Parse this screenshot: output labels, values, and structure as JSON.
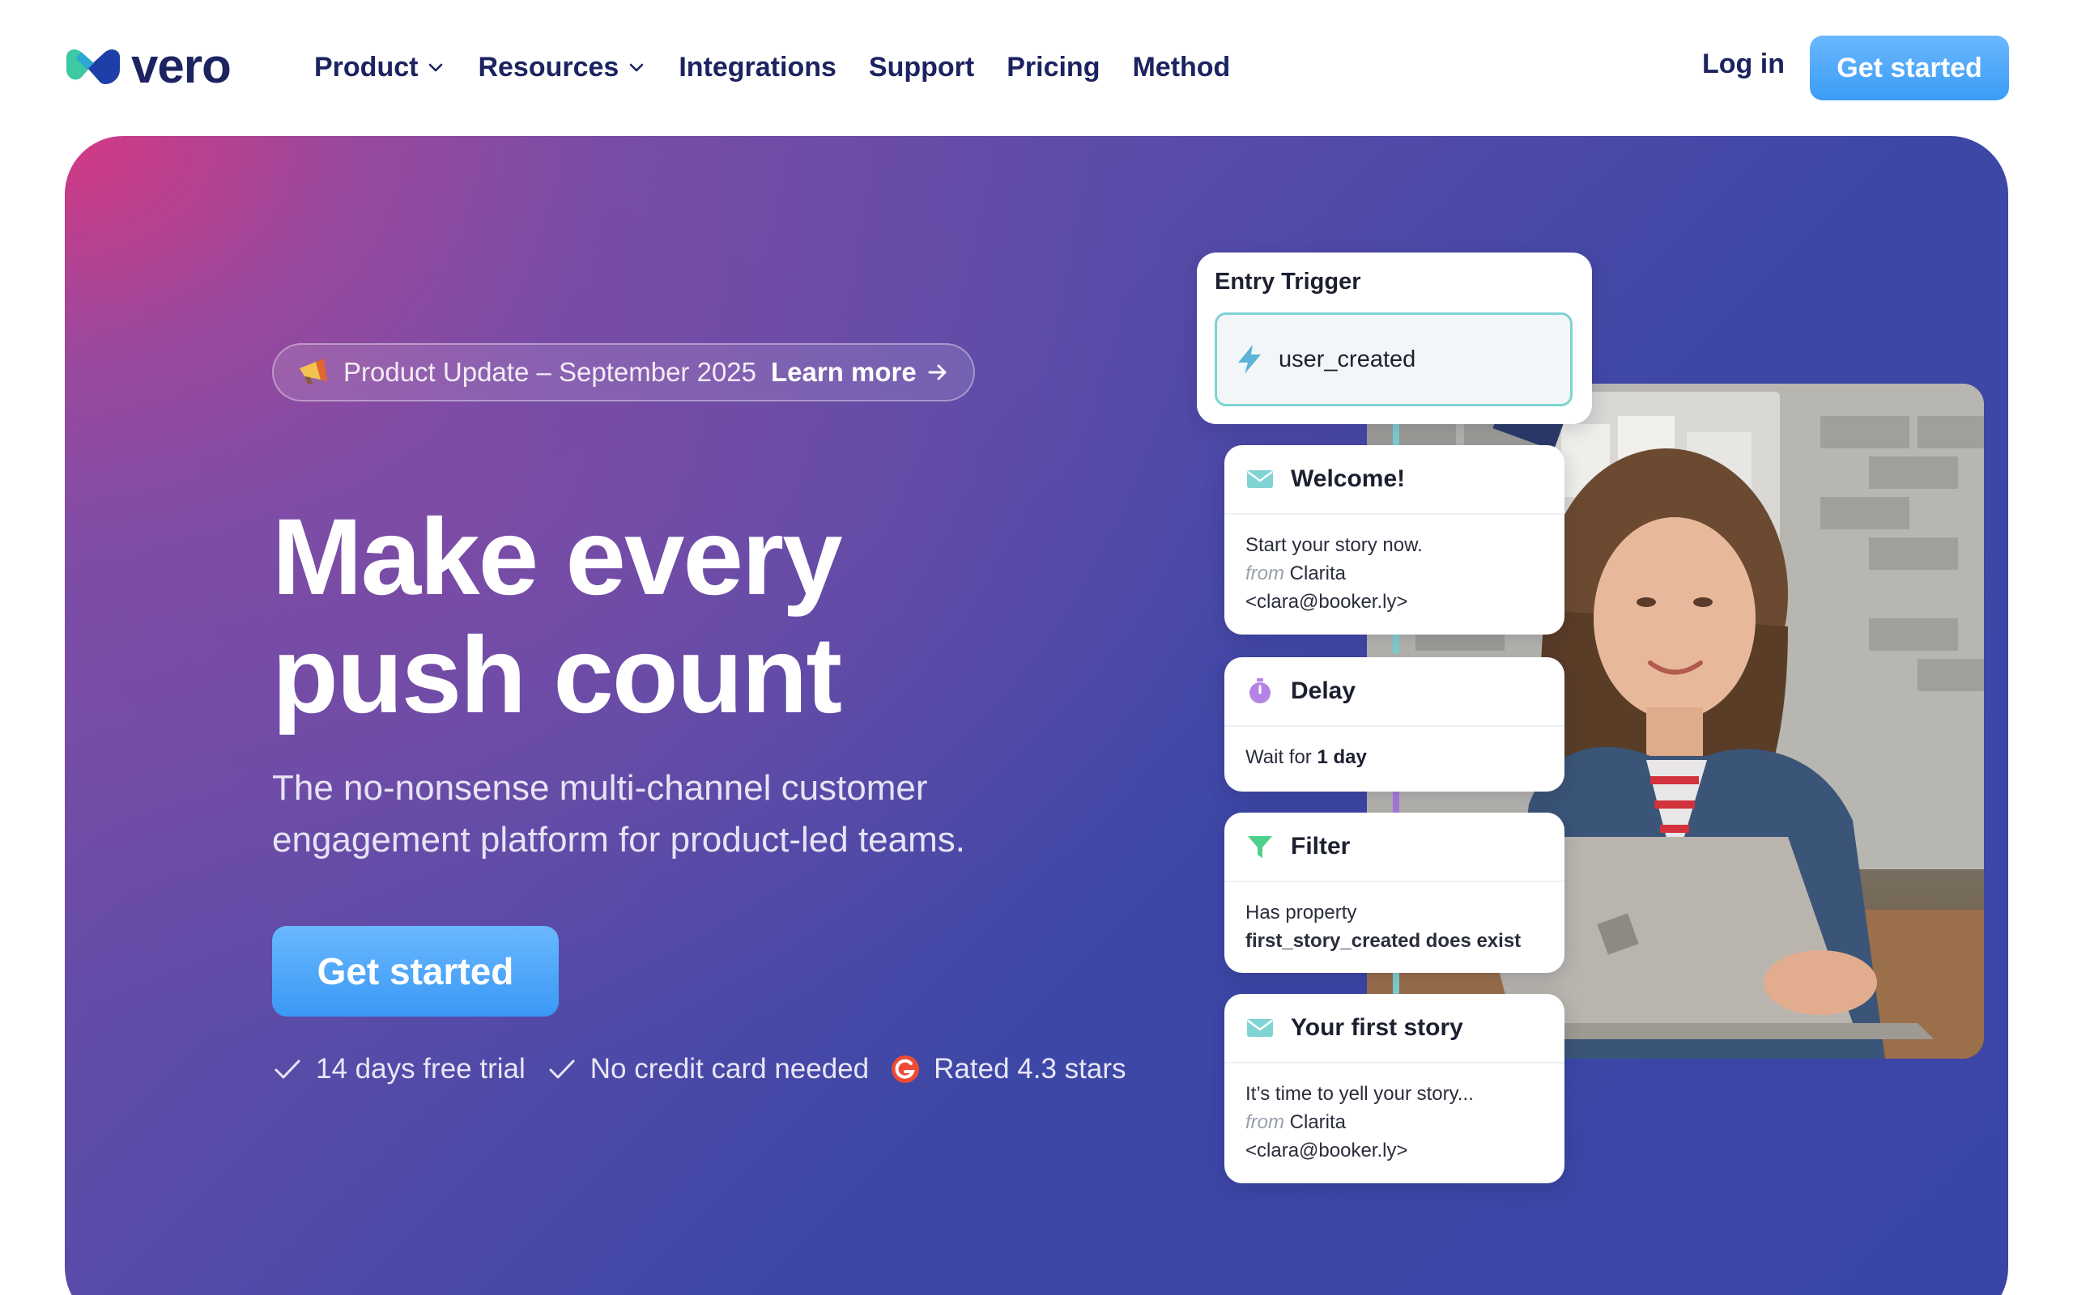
{
  "brand": {
    "name": "vero"
  },
  "nav": {
    "items": [
      {
        "label": "Product",
        "has_menu": true
      },
      {
        "label": "Resources",
        "has_menu": true
      },
      {
        "label": "Integrations",
        "has_menu": false
      },
      {
        "label": "Support",
        "has_menu": false
      },
      {
        "label": "Pricing",
        "has_menu": false
      },
      {
        "label": "Method",
        "has_menu": false
      }
    ],
    "login_label": "Log in",
    "cta_label": "Get started"
  },
  "hero": {
    "announcement": {
      "icon": "megaphone-icon",
      "text": "Product Update – September 2025",
      "link_label": "Learn more"
    },
    "headline_line1": "Make every",
    "headline_line2": "push count",
    "subhead_line1": "The no-nonsense multi-channel customer",
    "subhead_line2": "engagement platform for product-led teams.",
    "cta_label": "Get started",
    "perks": [
      {
        "icon": "check-icon",
        "label": "14 days free trial"
      },
      {
        "icon": "check-icon",
        "label": "No credit card needed"
      },
      {
        "icon": "g2-icon",
        "label": "Rated 4.3 stars"
      }
    ]
  },
  "workflow": {
    "trigger": {
      "title": "Entry Trigger",
      "event": "user_created",
      "icon": "lightning-icon"
    },
    "steps": [
      {
        "icon": "mail-icon",
        "title": "Welcome!",
        "line1": "Start your story now.",
        "from_label": "from",
        "from_name": "Clarita",
        "from_email": "<clara@booker.ly>"
      },
      {
        "icon": "timer-icon",
        "title": "Delay",
        "prefix": "Wait for",
        "value": "1 day"
      },
      {
        "icon": "filter-icon",
        "title": "Filter",
        "line1": "Has property",
        "line2": "first_story_created does exist"
      },
      {
        "icon": "mail-icon",
        "title": "Your first story",
        "line1": "It’s time to yell your story...",
        "from_label": "from",
        "from_name": "Clarita",
        "from_email": "<clara@booker.ly>"
      }
    ]
  },
  "colors": {
    "accent": "#3d9cf6",
    "nav_text": "#1c2360",
    "hero_pink": "#d63882",
    "hero_blue": "#3d47a6",
    "line_teal": "#7fd3d3",
    "line_purple": "#a97be0"
  }
}
